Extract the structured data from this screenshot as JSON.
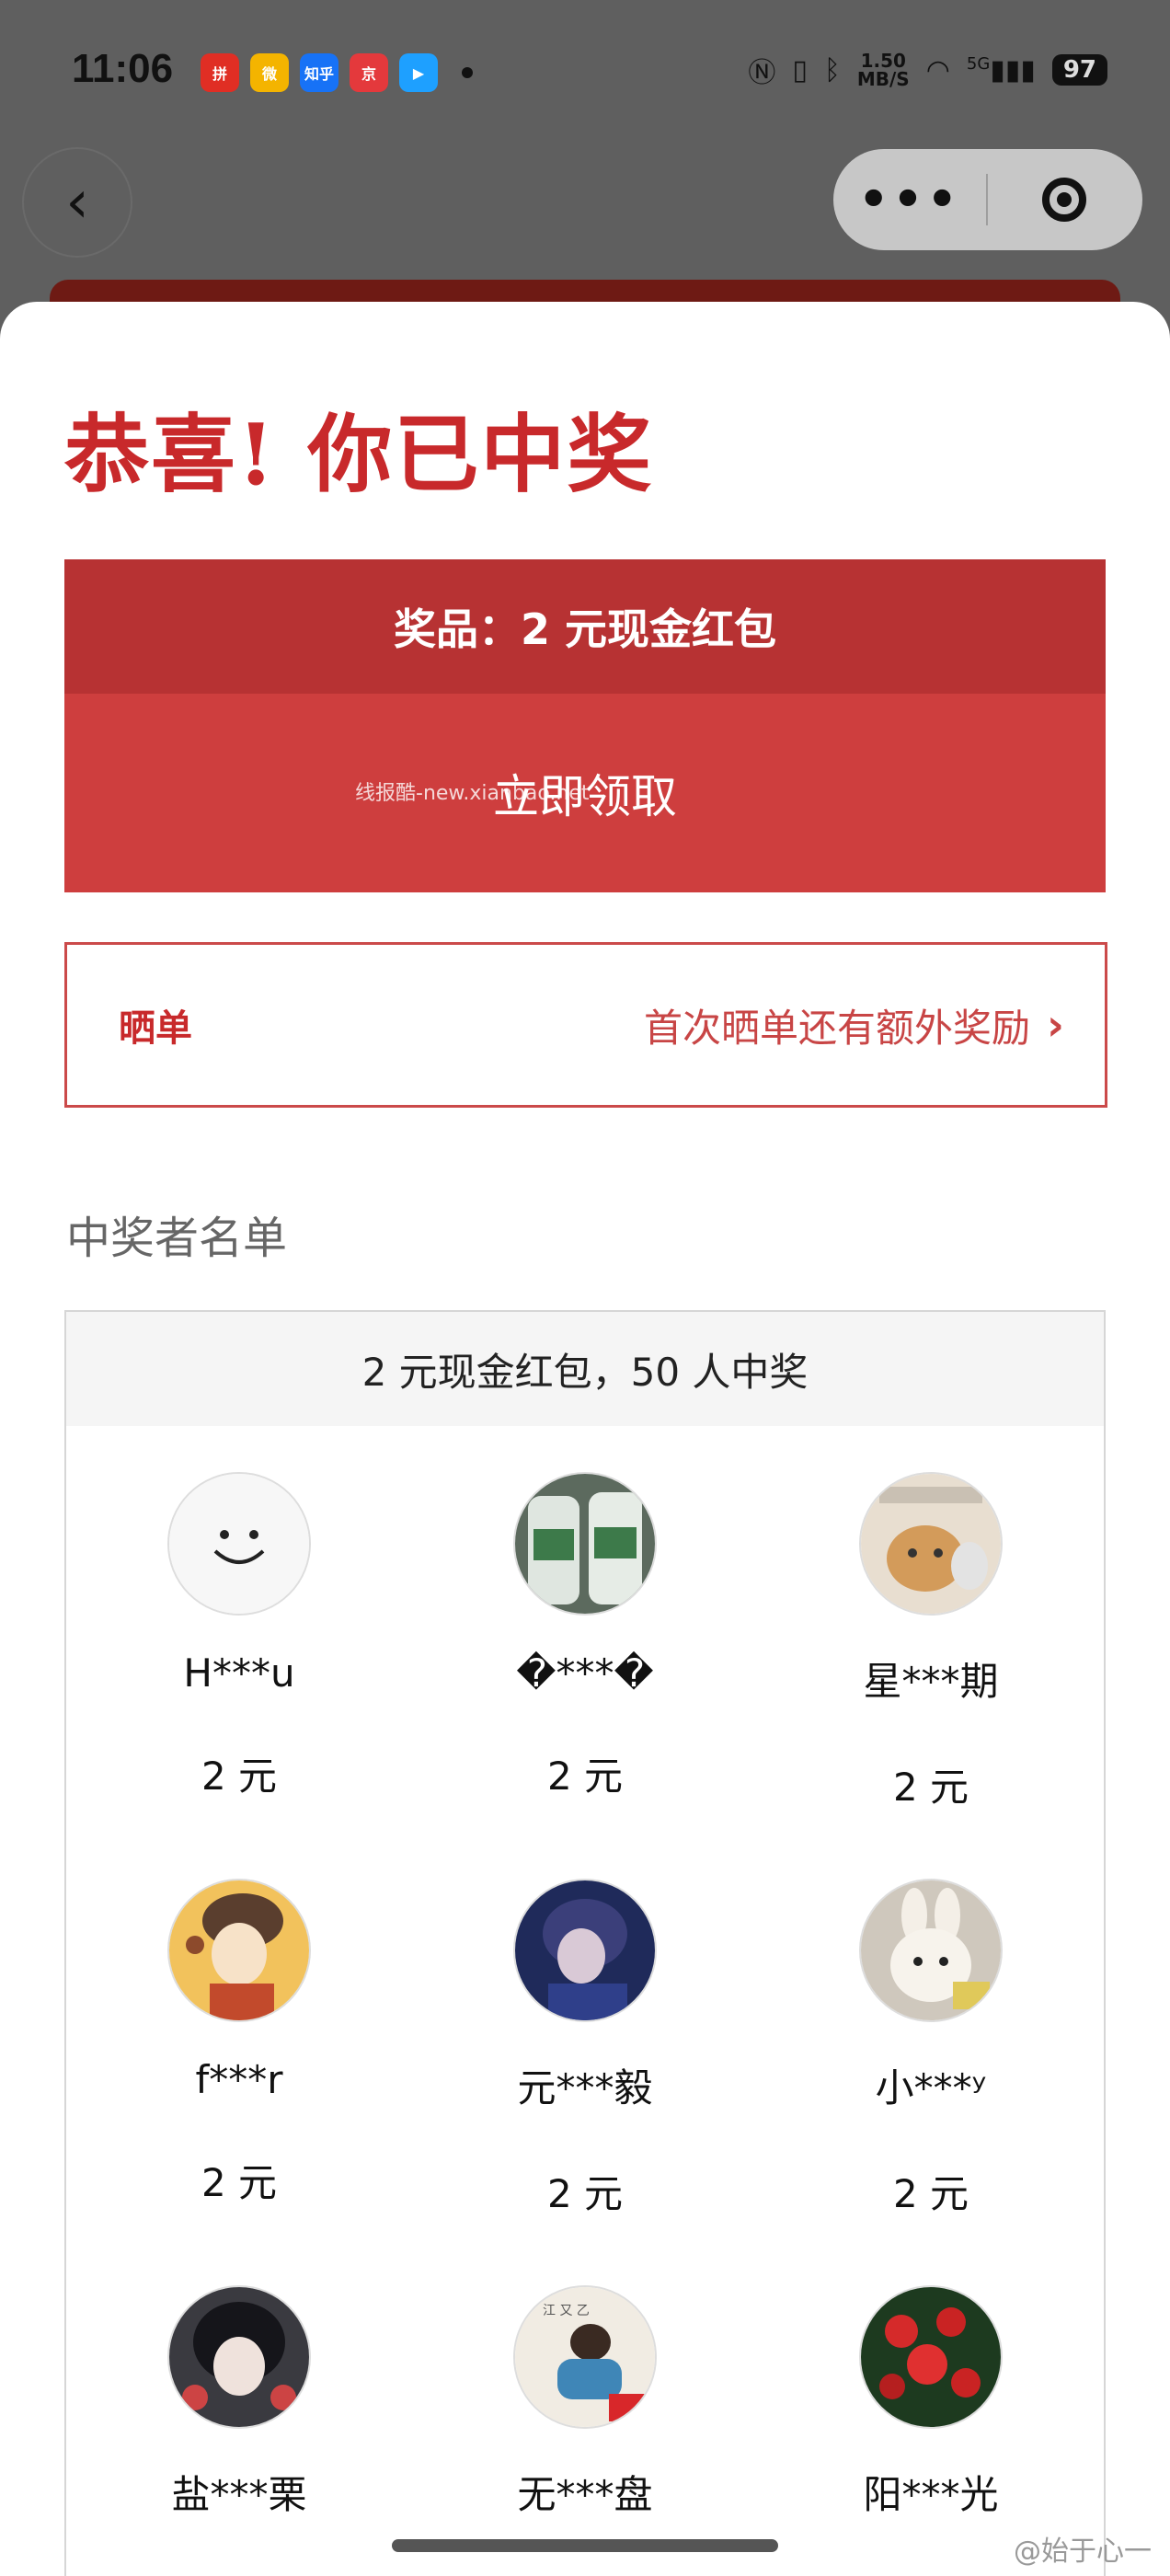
{
  "status_bar": {
    "time": "11:06",
    "apps": [
      {
        "name": "pinduoduo-icon",
        "label": "拼",
        "color": "#e02e24"
      },
      {
        "name": "weibo-icon",
        "label": "微",
        "color": "#f4b400"
      },
      {
        "name": "zhihu-icon",
        "label": "知乎",
        "color": "#1772f6"
      },
      {
        "name": "jd-icon",
        "label": "京",
        "color": "#e4393c"
      },
      {
        "name": "video-icon",
        "label": "▶",
        "color": "#1ea0ff"
      }
    ],
    "net_speed_value": "1.50",
    "net_speed_unit": "MB/S",
    "signal": "5G",
    "battery": "97"
  },
  "header": {
    "back_glyph": "‹",
    "more_glyph": "•••"
  },
  "result": {
    "title": "恭喜! 你已中奖",
    "prize_label": "奖品：2 元现金红包",
    "claim_button": "立即领取",
    "watermark": "线报酷-new.xianbao.net"
  },
  "share": {
    "label": "晒单",
    "hint": "首次晒单还有额外奖励",
    "chevron": "›"
  },
  "winners": {
    "title": "中奖者名单",
    "summary": "2 元现金红包，50 人中奖",
    "items": [
      {
        "name": "H***u",
        "amount": "2 元",
        "avatar": "smiley"
      },
      {
        "name": "�***�",
        "amount": "2 元",
        "avatar": "bottles"
      },
      {
        "name": "星***期",
        "amount": "2 元",
        "avatar": "cat"
      },
      {
        "name": "f***r",
        "amount": "2 元",
        "avatar": "girl"
      },
      {
        "name": "元***毅",
        "amount": "2 元",
        "avatar": "anime-boy"
      },
      {
        "name": "小***ʸ",
        "amount": "2 元",
        "avatar": "plush"
      },
      {
        "name": "盐***栗",
        "amount": "",
        "avatar": "anime-girl"
      },
      {
        "name": "无***盘",
        "amount": "",
        "avatar": "painting"
      },
      {
        "name": "阳***光",
        "amount": "",
        "avatar": "roses"
      }
    ]
  },
  "credit": "@始于心一",
  "colors": {
    "accent": "#c8292b",
    "prize_bg": "#b73233",
    "claim_bg": "#ce3e3e"
  }
}
